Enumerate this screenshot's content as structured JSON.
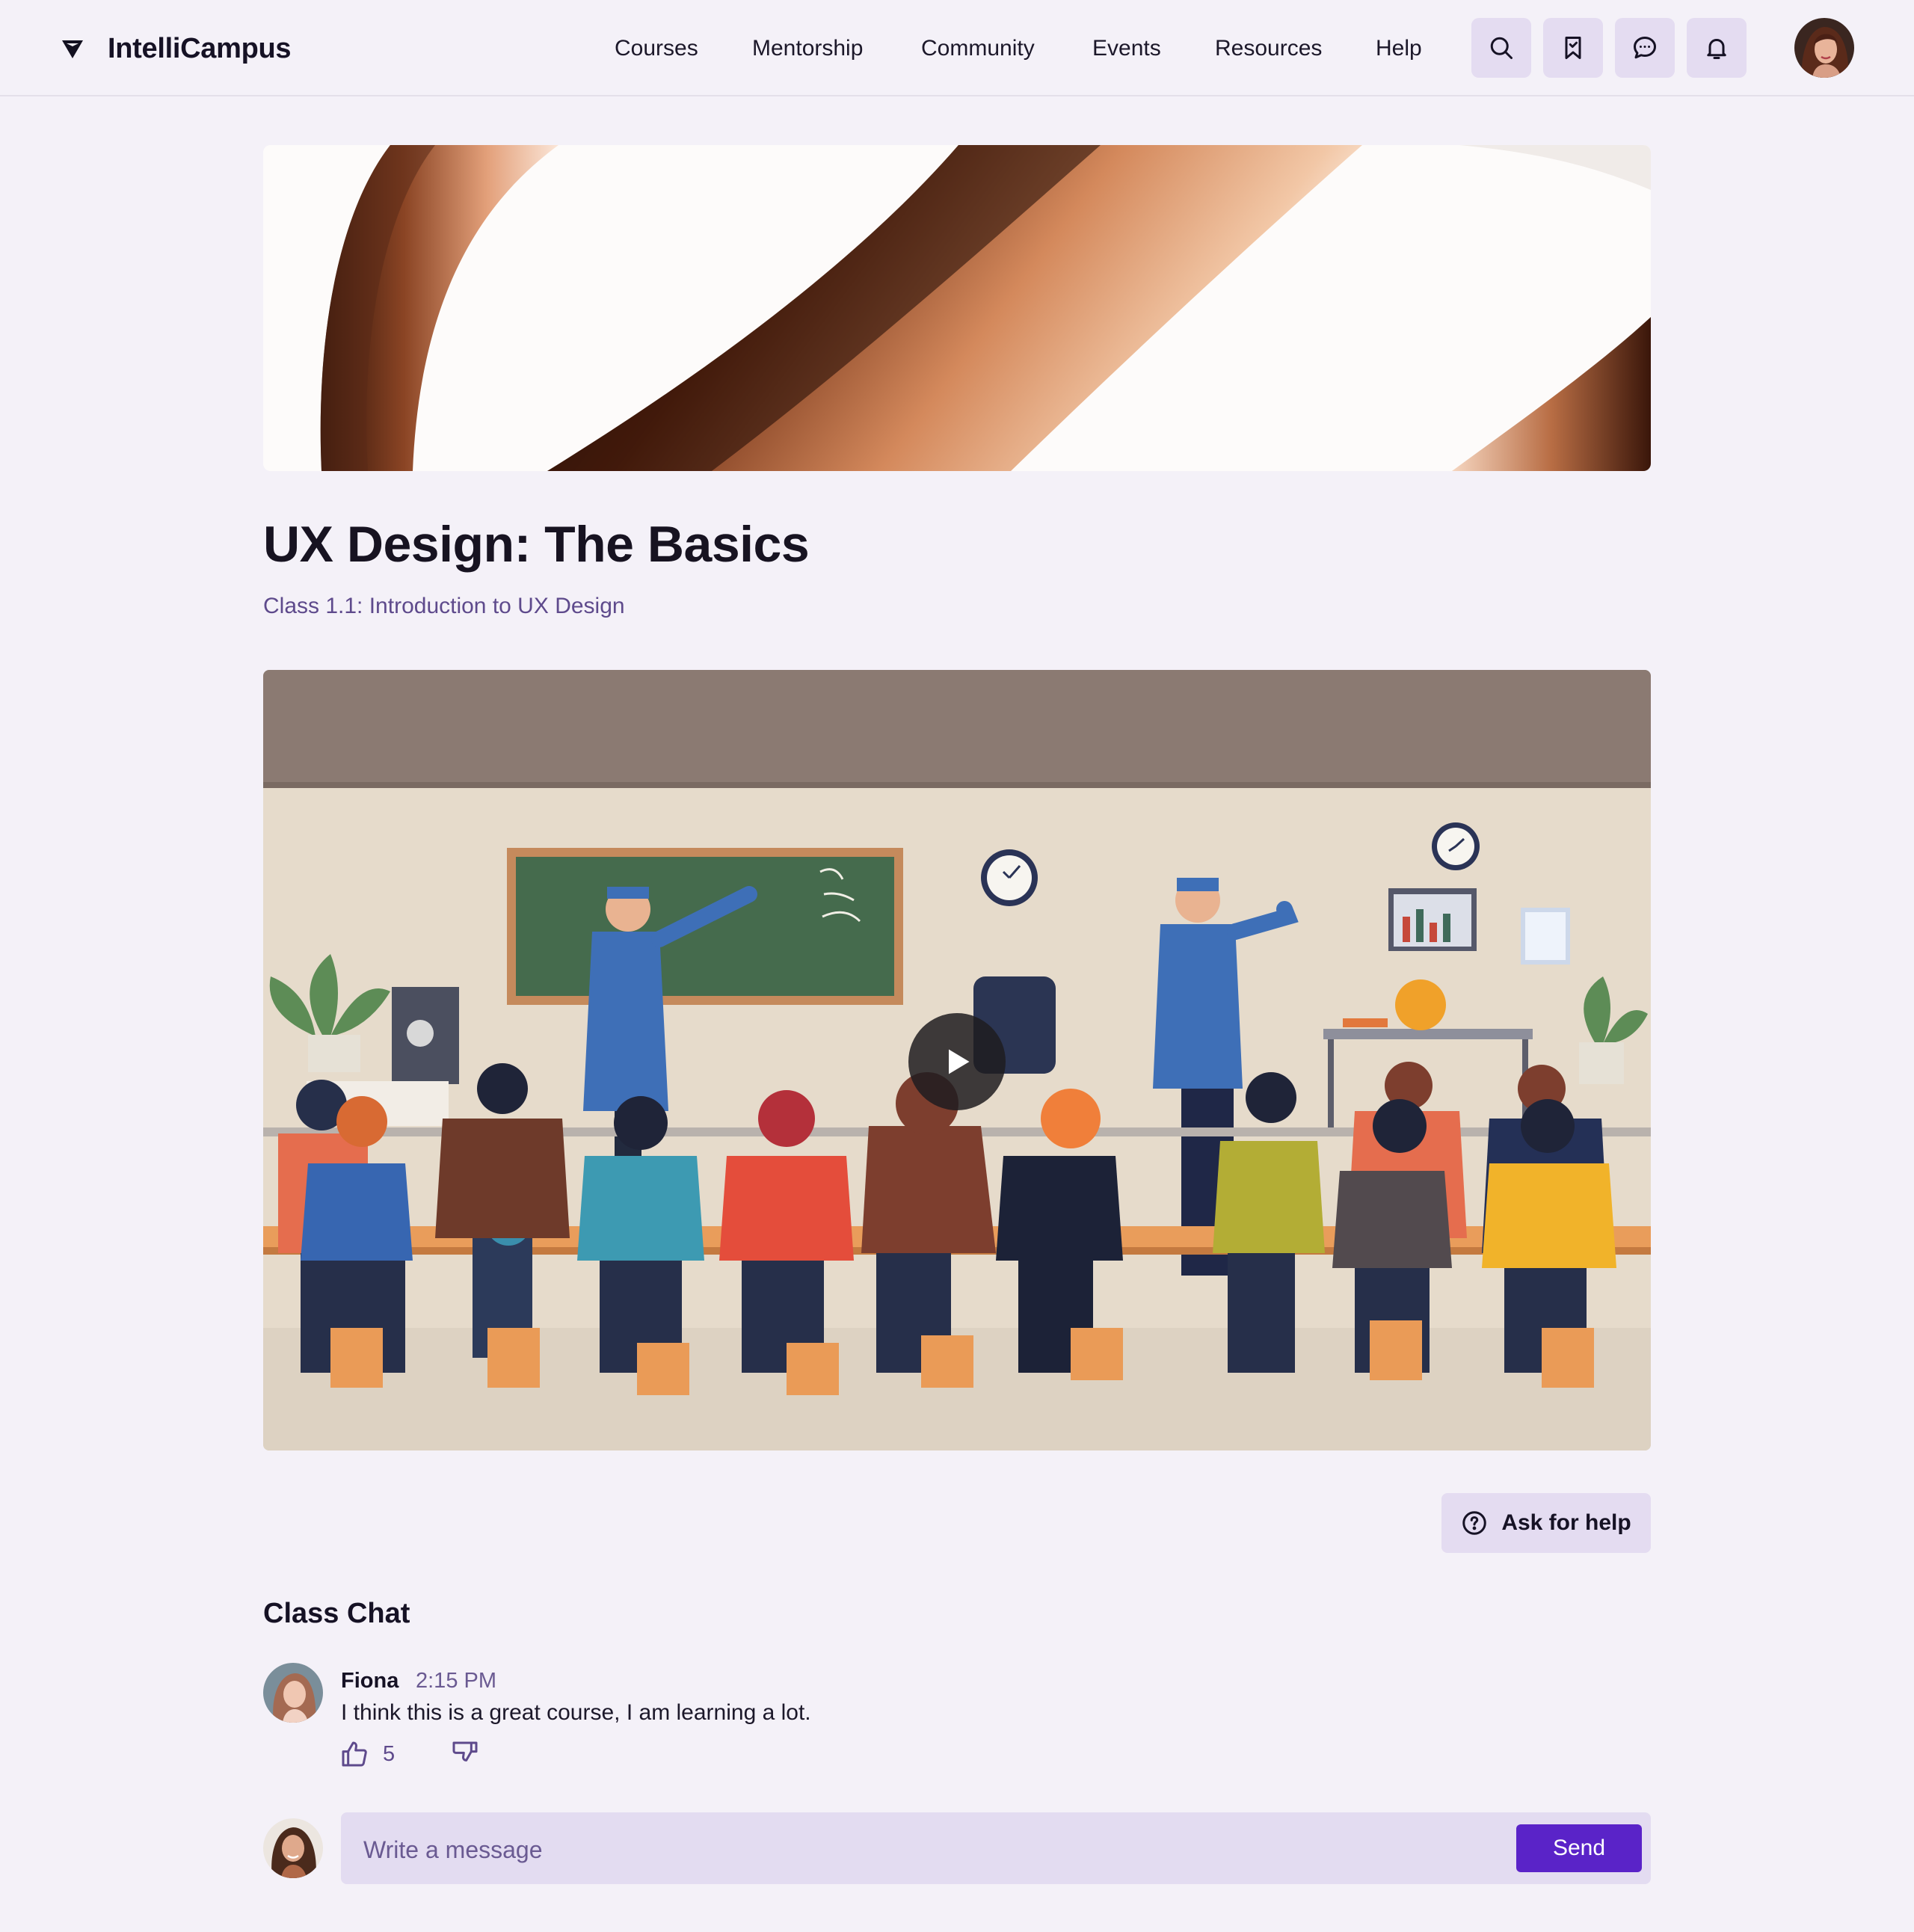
{
  "brand": {
    "name": "IntelliCampus",
    "logo_icon": "shield-diamond-icon"
  },
  "nav": {
    "links": [
      "Courses",
      "Mentorship",
      "Community",
      "Events",
      "Resources",
      "Help"
    ]
  },
  "toolbar": {
    "icons": [
      "search-icon",
      "bookmark-icon",
      "chat-bubble-icon",
      "bell-icon"
    ],
    "accent_bg": "#e4dcf1"
  },
  "course": {
    "title": "UX Design: The Basics",
    "class_label": "Class 1.1: Introduction to UX Design"
  },
  "video": {
    "play_icon": "play-icon"
  },
  "help": {
    "label": "Ask for help",
    "icon": "question-circle-icon"
  },
  "chat": {
    "title": "Class Chat",
    "messages": [
      {
        "author": "Fiona",
        "time": "2:15 PM",
        "text": "I think this is a great course, I am learning a lot.",
        "likes": "5"
      }
    ],
    "compose": {
      "placeholder": "Write a message",
      "send_label": "Send"
    }
  },
  "colors": {
    "background": "#f4f1f8",
    "accent": "#5a23c8",
    "subtitle": "#5e4a8c",
    "text": "#161225"
  }
}
